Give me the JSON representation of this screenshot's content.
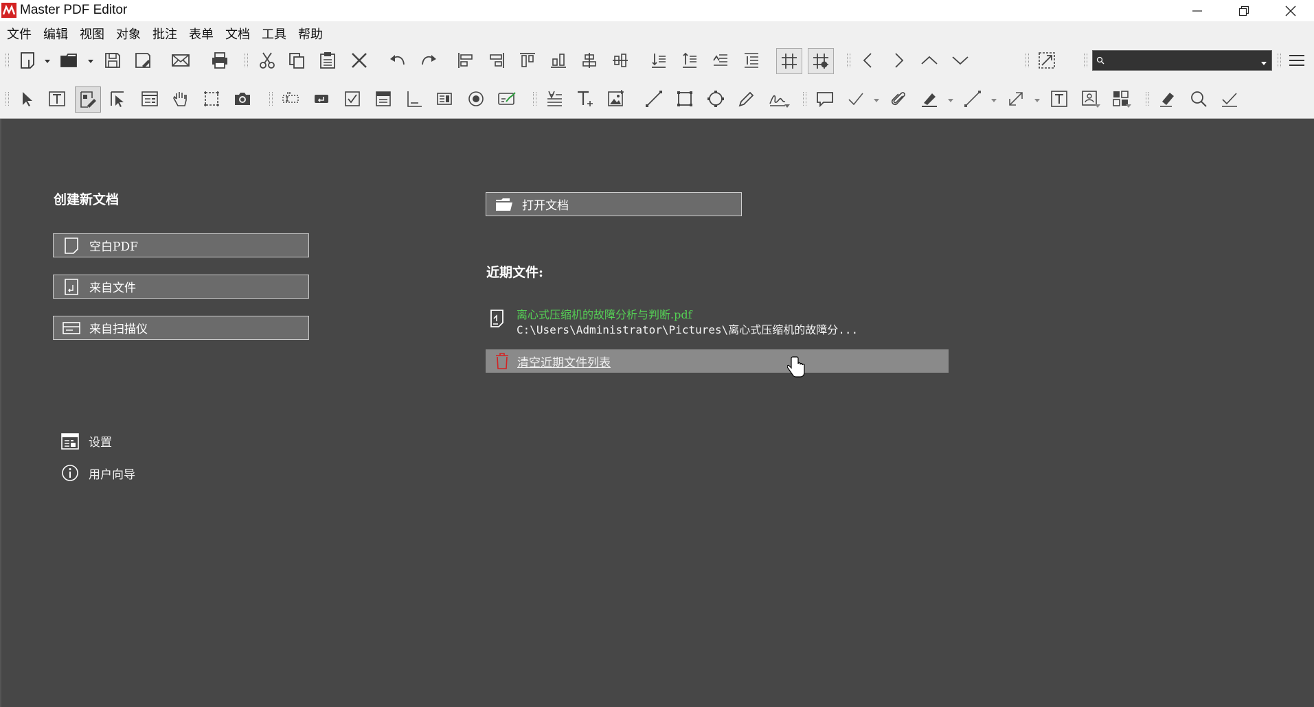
{
  "window": {
    "title": "Master PDF Editor",
    "minimize_icon": "minimize-icon",
    "restore_icon": "restore-icon",
    "close_icon": "close-icon"
  },
  "menu": [
    "文件",
    "编辑",
    "视图",
    "对象",
    "批注",
    "表单",
    "文档",
    "工具",
    "帮助"
  ],
  "search": {
    "placeholder": ""
  },
  "create": {
    "title": "创建新文档",
    "blank_pdf": "空白PDF",
    "from_file": "来自文件",
    "from_scanner": "来自扫描仪"
  },
  "open": {
    "label": "打开文档"
  },
  "recent": {
    "title": "近期文件:",
    "items": [
      {
        "name": "离心式压缩机的故障分析与判断.pdf",
        "path": "C:\\Users\\Administrator\\Pictures\\离心式压缩机的故障分..."
      }
    ],
    "clear_label": "清空近期文件列表"
  },
  "bottom_links": {
    "settings": "设置",
    "user_guide": "用户向导"
  },
  "colors": {
    "background": "#474747",
    "button_bg": "#6b6b6b",
    "recent_name": "#55d055",
    "brand_red": "#d32222"
  }
}
